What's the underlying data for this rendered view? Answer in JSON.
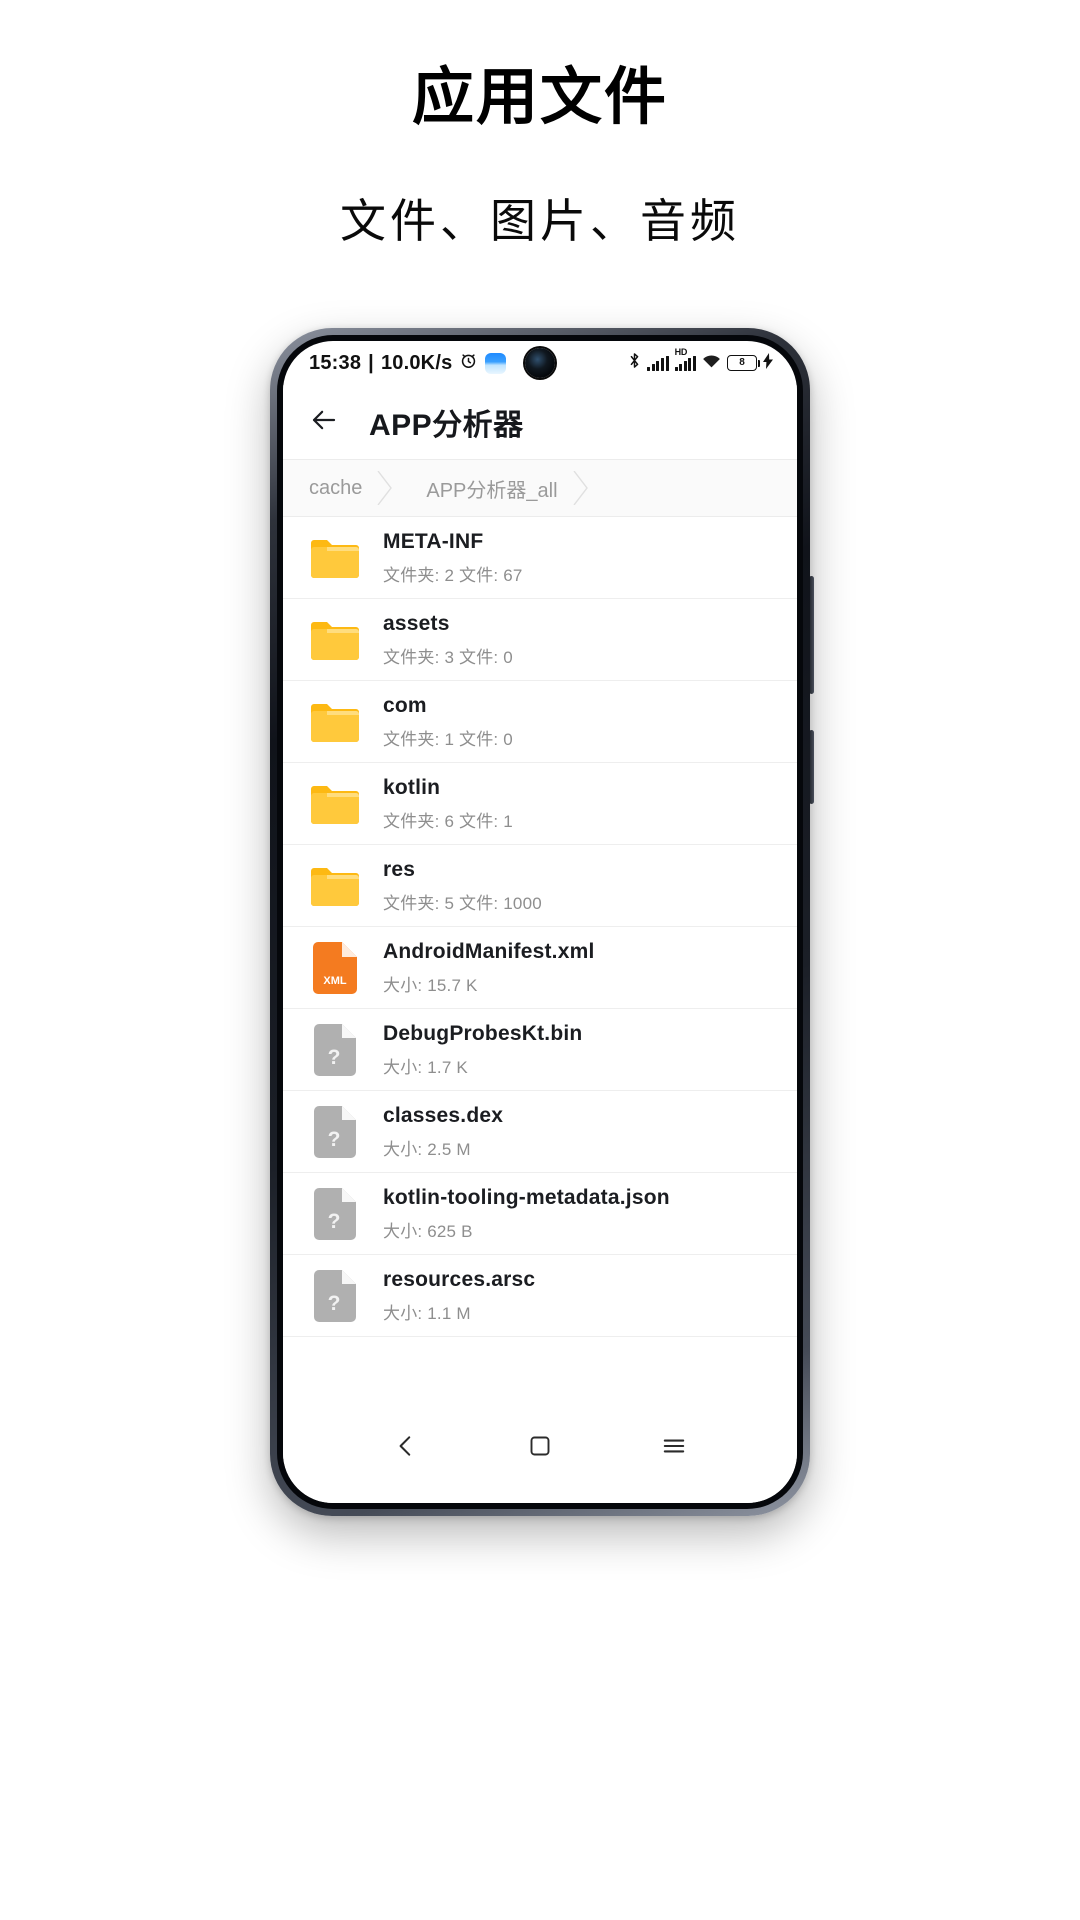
{
  "promo": {
    "title": "应用文件",
    "subtitle": "文件、图片、音频"
  },
  "statusbar": {
    "time": "15:38",
    "separator": "|",
    "netspeed": "10.0K/s",
    "alarm_icon": "alarm-clock-icon",
    "app_icon": "weather-app-icon",
    "camera": "punch-hole-camera",
    "bluetooth_icon": "bluetooth-icon",
    "signal_icon": "signal-bars-icon",
    "hd_label": "HD",
    "wifi_icon": "wifi-icon",
    "battery_level": "8",
    "charging_icon": "charging-bolt-icon"
  },
  "toolbar": {
    "back_icon": "back-arrow-icon",
    "title": "APP分析器"
  },
  "breadcrumb": {
    "items": [
      {
        "label": "cache"
      },
      {
        "label": "APP分析器_all"
      }
    ]
  },
  "filelist": {
    "folder_label": "文件夹:",
    "files_label": "文件:",
    "size_label": "大小:",
    "rows": [
      {
        "name": "META-INF",
        "sub": "文件夹: 2 文件: 67",
        "icon": "folder-icon",
        "icon_type": "folder"
      },
      {
        "name": "assets",
        "sub": "文件夹: 3 文件: 0",
        "icon": "folder-icon",
        "icon_type": "folder"
      },
      {
        "name": "com",
        "sub": "文件夹: 1 文件: 0",
        "icon": "folder-icon",
        "icon_type": "folder"
      },
      {
        "name": "kotlin",
        "sub": "文件夹: 6 文件: 1",
        "icon": "folder-icon",
        "icon_type": "folder"
      },
      {
        "name": "res",
        "sub": "文件夹: 5 文件: 1000",
        "icon": "folder-icon",
        "icon_type": "folder"
      },
      {
        "name": "AndroidManifest.xml",
        "sub": "大小: 15.7 K",
        "icon": "xml-file-icon",
        "icon_type": "xml",
        "badge": "XML"
      },
      {
        "name": "DebugProbesKt.bin",
        "sub": "大小: 1.7 K",
        "icon": "unknown-file-icon",
        "icon_type": "unknown"
      },
      {
        "name": "classes.dex",
        "sub": "大小: 2.5 M",
        "icon": "unknown-file-icon",
        "icon_type": "unknown"
      },
      {
        "name": "kotlin-tooling-metadata.json",
        "sub": "大小: 625 B",
        "icon": "unknown-file-icon",
        "icon_type": "unknown"
      },
      {
        "name": "resources.arsc",
        "sub": "大小: 1.1 M",
        "icon": "unknown-file-icon",
        "icon_type": "unknown"
      }
    ]
  },
  "navbar": {
    "back_icon": "nav-back-icon",
    "home_icon": "nav-home-icon",
    "recents_icon": "nav-recents-icon"
  },
  "colors": {
    "folder": "#FFC93C",
    "folder_tab": "#FDB913",
    "xml": "#F47B20",
    "unknown": "#B0B0B0",
    "text_primary": "#1B1D21",
    "text_secondary": "#8E8E8E",
    "divider": "#EEEEEE"
  }
}
